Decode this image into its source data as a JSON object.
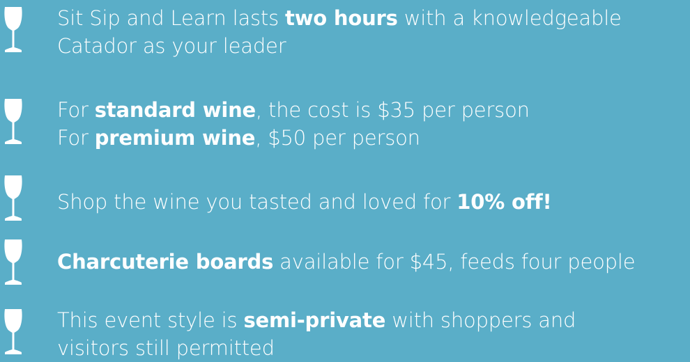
{
  "colors": {
    "background": "#5aaec8",
    "text": "#ffffff"
  },
  "icon": "wine-glass-icon",
  "items": [
    {
      "line1": {
        "pre": "Sit Sip and Learn lasts ",
        "bold": "two hours",
        "post": " with a knowledgeable"
      },
      "line2": "Catador as your leader"
    },
    {
      "line1": {
        "pre": "For ",
        "bold": "standard wine",
        "post": ", the cost is $35 per person"
      },
      "line2": {
        "pre": "For ",
        "bold": "premium wine",
        "post": ", $50 per person"
      }
    },
    {
      "line1": {
        "pre": "Shop the wine you tasted and loved for ",
        "bold": "10% off!"
      }
    },
    {
      "line1": {
        "bold": "Charcuterie boards",
        "post": " available for $45, feeds four people"
      }
    },
    {
      "line1": {
        "pre": "This event style is ",
        "bold": "semi-private",
        "post": " with shoppers and"
      },
      "line2": "visitors still permitted"
    }
  ]
}
